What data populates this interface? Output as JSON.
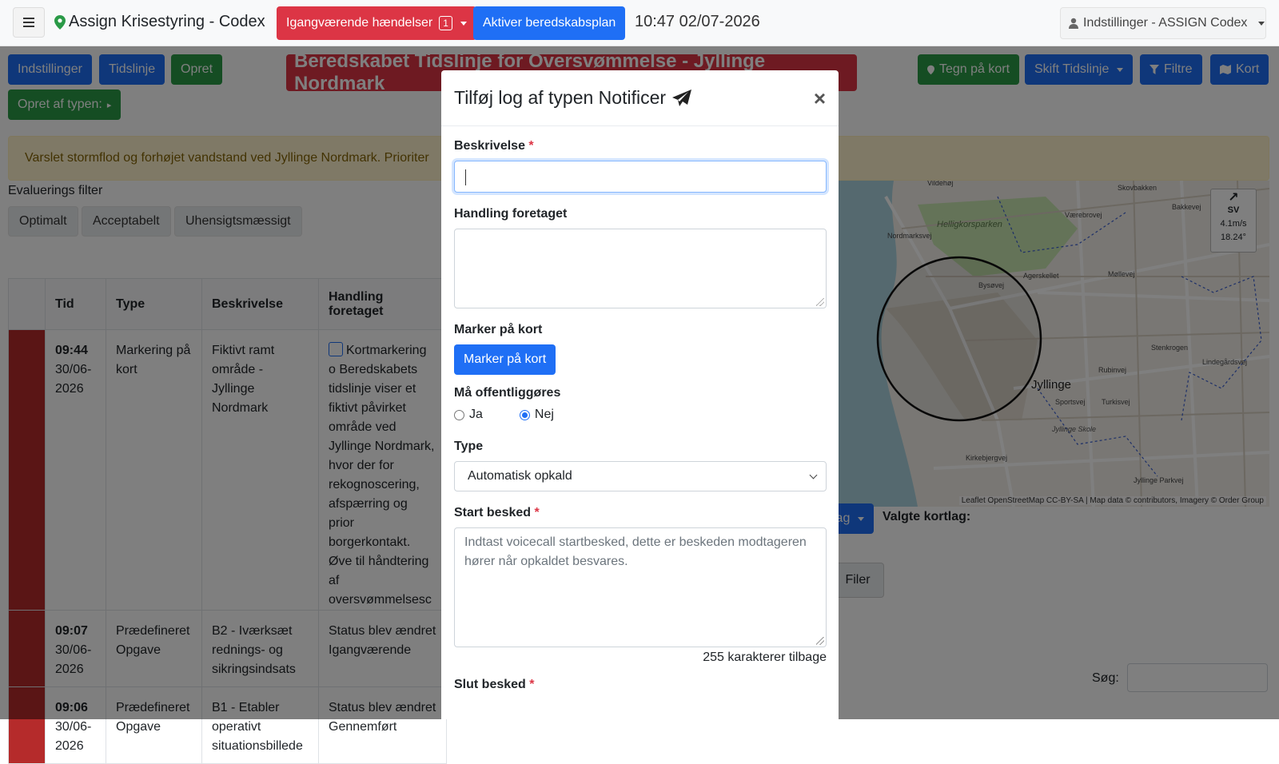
{
  "navbar": {
    "brand": "Assign Krisestyring - Codex",
    "ongoing_label": "Igangværende hændelser",
    "ongoing_count": "1",
    "activate_label": "Aktiver beredskabsplan",
    "clock": "10:47 02/07-2026",
    "settings_label": "Indstillinger - ASSIGN Codex"
  },
  "toolbar": {
    "settings": "Indstillinger",
    "timeline": "Tidslinje",
    "create": "Opret",
    "create_by_type": "Opret af typen:",
    "title": "Beredskabet Tidslinje for Oversvømmelse - Jyllinge Nordmark",
    "draw_on_map": "Tegn på kort",
    "switch_timeline": "Skift Tidslinje",
    "filters": "Filtre",
    "map": "Kort"
  },
  "notice": "Varslet stormflod og forhøjet vandstand ved Jyllinge Nordmark. Prioriter",
  "evaluation": {
    "label": "Evaluerings filter",
    "options": [
      "Optimalt",
      "Acceptabelt",
      "Uhensigtsmæssigt"
    ]
  },
  "table": {
    "headers": [
      "",
      "Tid",
      "Type",
      "Beskrivelse",
      "Handling foretaget"
    ],
    "rows": [
      {
        "time": "09:44",
        "date": "30/06-2026",
        "type": "Markering på kort",
        "desc": "Fiktivt ramt område - Jyllinge Nordmark",
        "action": "Kortmarkering o Beredskabets tidslinje viser et fiktivt påvirket område ved Jyllinge Nordmark, hvor der for rekognoscering, afspærring og prior borgerkontakt. Øve til håndtering af oversvømmelsesc"
      },
      {
        "time": "09:07",
        "date": "30/06-2026",
        "type": "Prædefineret Opgave",
        "desc": "B2 - Iværksæt rednings- og sikringsindsats",
        "action": "Status blev ændret Igangværende"
      },
      {
        "time": "09:06",
        "date": "30/06-2026",
        "type": "Prædefineret Opgave",
        "desc": "B1 - Etabler operativt situationsbillede",
        "action": "Status blev ændret Gennemført"
      }
    ]
  },
  "map": {
    "compass_dir": "SV",
    "wind_speed": "4.1m/s",
    "wind_deg": "18.24°",
    "labels": [
      "Helligkorsparken",
      "Jyllinge",
      "Jyllinge Skole",
      "Møllevej",
      "Agerskellet",
      "Nordmarksvej",
      "Lindegårdsvej",
      "Jyllinge Parkvej",
      "Kirkebjergvej",
      "Stenkrogen",
      "Sportsvej",
      "Rubinvej",
      "Turkisvej",
      "Bysøvej",
      "Skovbakken",
      "Bakkevej",
      "Vildehøj",
      "Værebrovej"
    ],
    "attribution": "Leaflet OpenStreetMap CC-BY-SA | Map data © contributors, Imagery © Order Group",
    "layers_btn": "lag",
    "chosen_layers": "Valgte kortlag:"
  },
  "files_label": "Filer",
  "search_label": "Søg:",
  "modal": {
    "title": "Tilføj log af typen Notificer",
    "description_label": "Beskrivelse",
    "description_value": "",
    "action_label": "Handling foretaget",
    "mark_label": "Marker på kort",
    "mark_button": "Marker på kort",
    "publish_label": "Må offentliggøres",
    "publish_yes": "Ja",
    "publish_no": "Nej",
    "type_label": "Type",
    "type_value": "Automatisk opkald",
    "start_label": "Start besked",
    "start_placeholder": "Indtast voicecall startbesked, dette er beskeden modtageren hører når opkaldet besvares.",
    "chars_left": "255 karakterer tilbage",
    "end_label": "Slut besked",
    "required_mark": "*"
  },
  "colors": {
    "primary": "#1f6ff5",
    "success": "#2a9a47",
    "danger": "#dc3545",
    "row_marker": "#b52b2b",
    "notice_bg": "#fff3cd"
  }
}
